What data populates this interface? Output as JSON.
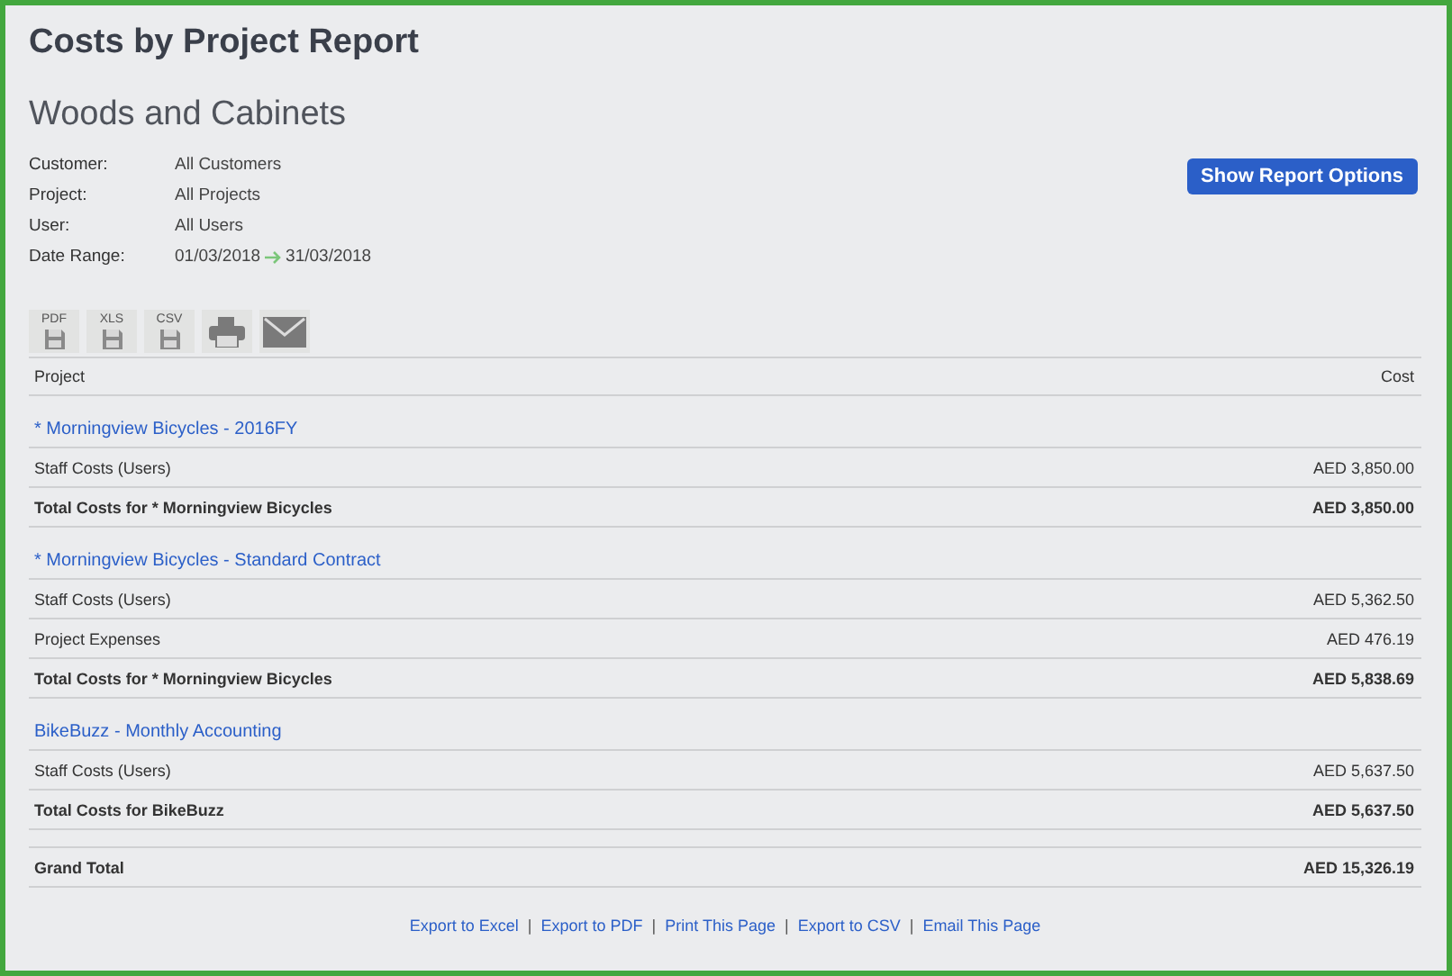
{
  "report_title": "Costs by Project Report",
  "company": "Woods and Cabinets",
  "filters": [
    {
      "label": "Customer:",
      "value": "All Customers"
    },
    {
      "label": "Project:",
      "value": "All Projects"
    },
    {
      "label": "User:",
      "value": "All Users"
    },
    {
      "label": "Date Range:",
      "value": "01/03/2018",
      "value_end": "31/03/2018"
    }
  ],
  "options_button": "Show Report Options",
  "toolbar": [
    {
      "kind": "export",
      "label": "PDF"
    },
    {
      "kind": "export",
      "label": "XLS"
    },
    {
      "kind": "export",
      "label": "CSV"
    },
    {
      "kind": "print"
    },
    {
      "kind": "email"
    }
  ],
  "table": {
    "columns": [
      "Project",
      "Cost"
    ],
    "groups": [
      {
        "title": "* Morningview Bicycles - 2016FY",
        "rows": [
          {
            "kind": "line",
            "label": "Staff Costs (Users)",
            "cost": "AED 3,850.00"
          },
          {
            "kind": "total",
            "label": "Total Costs for * Morningview Bicycles",
            "cost": "AED 3,850.00"
          }
        ]
      },
      {
        "title": "* Morningview Bicycles - Standard Contract",
        "rows": [
          {
            "kind": "line",
            "label": "Staff Costs (Users)",
            "cost": "AED 5,362.50"
          },
          {
            "kind": "line",
            "label": "Project Expenses",
            "cost": "AED 476.19"
          },
          {
            "kind": "total",
            "label": "Total Costs for * Morningview Bicycles",
            "cost": "AED 5,838.69"
          }
        ]
      },
      {
        "title": "BikeBuzz - Monthly Accounting",
        "rows": [
          {
            "kind": "line",
            "label": "Staff Costs (Users)",
            "cost": "AED 5,637.50"
          },
          {
            "kind": "total",
            "label": "Total Costs for BikeBuzz",
            "cost": "AED 5,637.50"
          }
        ]
      }
    ],
    "grand_total": {
      "label": "Grand Total",
      "cost": "AED 15,326.19"
    }
  },
  "footer_links": [
    "Export to Excel",
    "Export to PDF",
    "Print This Page",
    "Export to CSV",
    "Email This Page"
  ],
  "footer_separator": "|"
}
